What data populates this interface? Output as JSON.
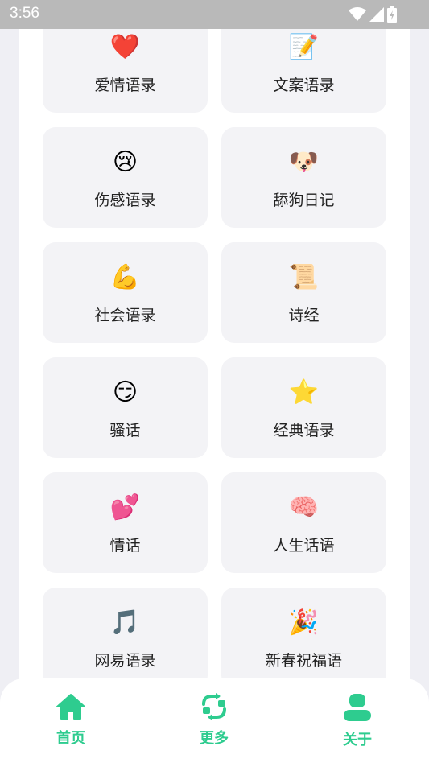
{
  "status_bar": {
    "time": "3:56"
  },
  "accent_color": "#2ecc8f",
  "cards": [
    {
      "icon": "❤️",
      "icon_name": "red-heart-icon",
      "label": "爱情语录",
      "id": "love-quotes"
    },
    {
      "icon": "📝",
      "icon_name": "memo-icon",
      "label": "文案语录",
      "id": "copywriting-quotes"
    },
    {
      "icon": "😢",
      "icon_name": "crying-face-icon",
      "label": "伤感语录",
      "id": "sad-quotes"
    },
    {
      "icon": "🐶",
      "icon_name": "dog-face-icon",
      "label": "舔狗日记",
      "id": "simp-diary"
    },
    {
      "icon": "💪",
      "icon_name": "flexed-biceps-icon",
      "label": "社会语录",
      "id": "society-quotes"
    },
    {
      "icon": "📜",
      "icon_name": "scroll-icon",
      "label": "诗经",
      "id": "book-of-songs"
    },
    {
      "icon": "😏",
      "icon_name": "smirking-face-icon",
      "label": "骚话",
      "id": "flirty-talk"
    },
    {
      "icon": "⭐",
      "icon_name": "star-icon",
      "label": "经典语录",
      "id": "classic-quotes"
    },
    {
      "icon": "💕",
      "icon_name": "two-hearts-icon",
      "label": "情话",
      "id": "love-words"
    },
    {
      "icon": "🧠",
      "icon_name": "brain-icon",
      "label": "人生话语",
      "id": "life-words"
    },
    {
      "icon": "🎵",
      "icon_name": "music-note-icon",
      "label": "网易语录",
      "id": "netease-quotes"
    },
    {
      "icon": "🎉",
      "icon_name": "party-popper-icon",
      "label": "新春祝福语",
      "id": "new-year-greetings"
    }
  ],
  "bottom_nav": {
    "items": [
      {
        "label": "首页",
        "icon_name": "home-icon"
      },
      {
        "label": "更多",
        "icon_name": "refresh-icon"
      },
      {
        "label": "关于",
        "icon_name": "user-icon"
      }
    ]
  }
}
